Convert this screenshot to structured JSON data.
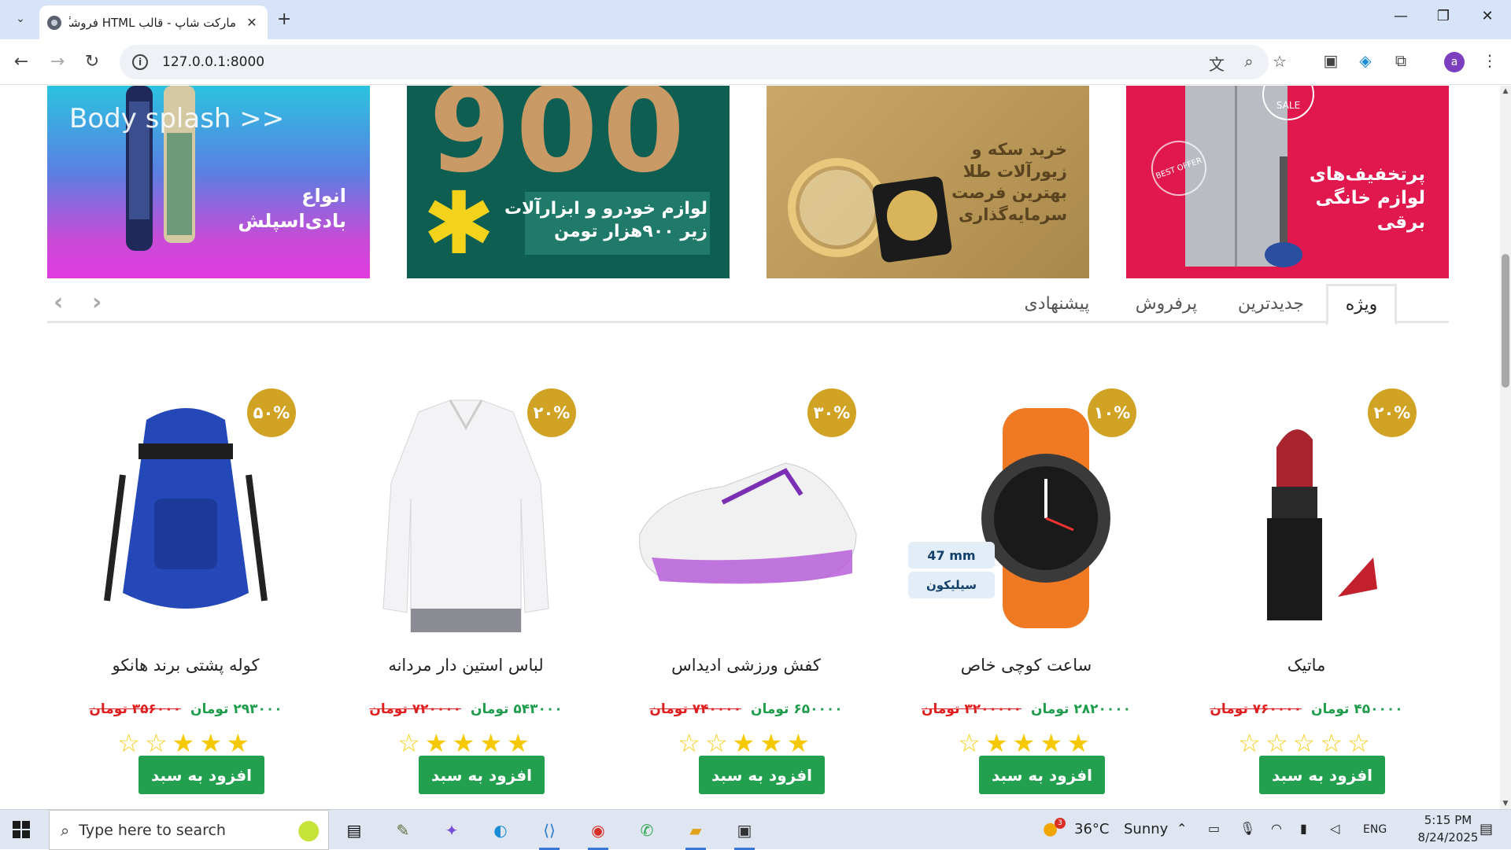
{
  "browser": {
    "tab_title": "مارکت شاپ - قالب HTML فروشگ",
    "close_symbol": "✕",
    "new_tab_symbol": "+",
    "url": "127.0.0.1:8000",
    "profile_initial": "a"
  },
  "banners": [
    {
      "text_en": "Body splash  >>",
      "text_fa": "انواع\nبادی‌اسپلش"
    },
    {
      "big": "900",
      "text_fa": "لوازم خودرو و ابزارآلات\nزیر ۹۰۰هزار تومن"
    },
    {
      "text_fa": "خرید سکه و\nزیورآلات طلا\nبهترین فرصت\nسرمایه‌گذاری"
    },
    {
      "badge_en": "SALE",
      "badge2_en": "BEST OFFER",
      "text_fa": "پرتخفیف‌های\nلوازم خانگی\nبرقی"
    }
  ],
  "product_tabs": [
    {
      "label": "ویژه",
      "active": true
    },
    {
      "label": "جدیدترین",
      "active": false
    },
    {
      "label": "پرفروش",
      "active": false
    },
    {
      "label": "پیشنهادی",
      "active": false
    }
  ],
  "products": [
    {
      "name": "ماتیک",
      "discount": "۲۰%",
      "price": "۴۵۰۰۰۰ تومان",
      "old_price": "۷۶۰۰۰۰ تومان",
      "rating": 0,
      "add_label": "افزود به سبد"
    },
    {
      "name": "ساعت کوچی خاص",
      "discount": "۱۰%",
      "price": "۲۸۲۰۰۰۰ تومان",
      "old_price": "۳۲۰۰۰۰۰ تومان",
      "rating": 4,
      "add_label": "افزود به سبد",
      "badge_size": "47 mm",
      "badge_material": "سیلیکون"
    },
    {
      "name": "کفش ورزشی ادیداس",
      "discount": "۳۰%",
      "price": "۶۵۰۰۰۰ تومان",
      "old_price": "۷۴۰۰۰۰ تومان",
      "rating": 3,
      "add_label": "افزود به سبد"
    },
    {
      "name": "لباس استین دار مردانه",
      "discount": "۲۰%",
      "price": "۵۴۳۰۰۰ تومان",
      "old_price": "۷۲۰۰۰۰ تومان",
      "rating": 4,
      "add_label": "افزود به سبد"
    },
    {
      "name": "کوله پشتی برند هانکو",
      "discount": "۵۰%",
      "price": "۲۹۳۰۰۰ تومان",
      "old_price": "۳۵۶۰۰۰ تومان",
      "rating": 3,
      "add_label": "افزود به سبد"
    }
  ],
  "taskbar": {
    "search_placeholder": "Type here to search",
    "weather_temp": "36°C",
    "weather_desc": "Sunny",
    "weather_badge": "3",
    "lang": "ENG",
    "time": "5:15 PM",
    "date": "8/24/2025"
  }
}
